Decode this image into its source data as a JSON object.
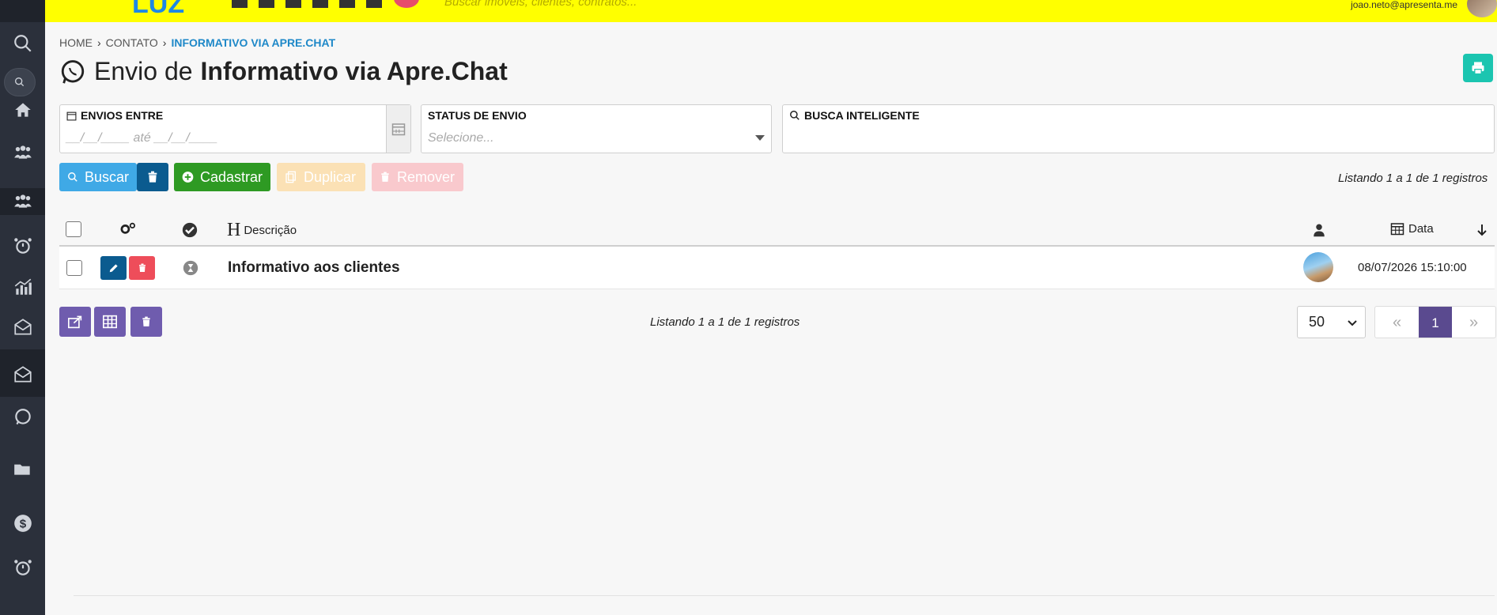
{
  "topbar": {
    "logo": "LUZ",
    "search_placeholder": "Buscar imóveis, clientes, contratos...",
    "user_email": "joao.neto@apresenta.me"
  },
  "sidebar": {
    "items": [
      "search-icon",
      "search-icon",
      "home-icon",
      "users-icon",
      "users-icon",
      "alarm-icon",
      "chart-icon",
      "mail-icon",
      "mail-icon",
      "whatsapp-icon",
      "folder-icon",
      "dollar-icon",
      "alarm-icon"
    ]
  },
  "breadcrumb": {
    "home": "HOME",
    "contato": "CONTATO",
    "current": "INFORMATIVO VIA APRE.CHAT"
  },
  "page": {
    "title_light": "Envio de",
    "title_bold": "Informativo via Apre.Chat"
  },
  "filters": {
    "envios_label": "ENVIOS ENTRE",
    "envios_placeholder": "__/__/____  até  __/__/____",
    "status_label": "STATUS DE ENVIO",
    "status_placeholder": "Selecione...",
    "busca_label": "BUSCA INTELIGENTE"
  },
  "actions": {
    "buscar": "Buscar",
    "cadastrar": "Cadastrar",
    "duplicar": "Duplicar",
    "remover": "Remover"
  },
  "table": {
    "listing_top": "Listando 1 a 1 de 1 registros",
    "col_descricao": "Descrição",
    "col_data": "Data",
    "rows": [
      {
        "descricao": "Informativo aos clientes",
        "data": "08/07/2026 15:10:00"
      }
    ]
  },
  "pagination": {
    "listing_bottom": "Listando 1 a 1 de 1 registros",
    "page_size": "50",
    "current_page": "1",
    "prev": "«",
    "next": "»"
  },
  "colors": {
    "topbar": "#ffff00",
    "sidebar": "#2b303b",
    "primary": "#3fa9e6",
    "success": "#2e9a23",
    "purple": "#6f5cae",
    "teal": "#1bc5b0"
  }
}
